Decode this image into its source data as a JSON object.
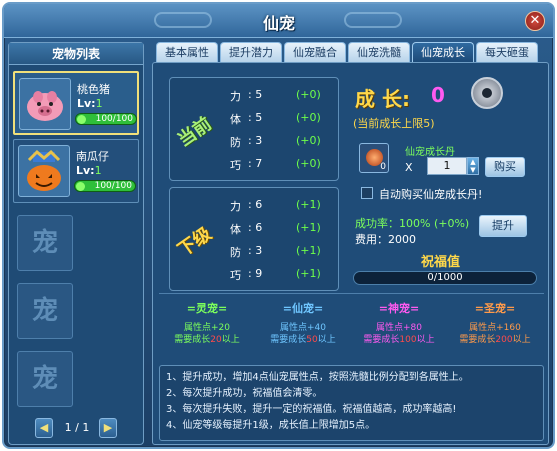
{
  "window": {
    "title": "仙宠"
  },
  "left": {
    "header": "宠物列表",
    "pets": [
      {
        "name": "桃色猪",
        "level_label": "Lv:",
        "level": "1",
        "hp": "100/100"
      },
      {
        "name": "南瓜仔",
        "level_label": "Lv:",
        "level": "1",
        "hp": "100/100"
      }
    ],
    "empty_slot_char": "宠",
    "pager": {
      "text": "1 / 1",
      "prev": "◀",
      "next": "▶"
    }
  },
  "tabs": [
    "基本属性",
    "提升潜力",
    "仙宠融合",
    "仙宠洗髓",
    "仙宠成长",
    "每天砸蛋"
  ],
  "active_tab": 4,
  "current": {
    "label": "当前",
    "rows": [
      {
        "k": "力",
        "v": ": 5",
        "d": "(+0)"
      },
      {
        "k": "体",
        "v": ": 5",
        "d": "(+0)"
      },
      {
        "k": "防",
        "v": ": 3",
        "d": "(+0)"
      },
      {
        "k": "巧",
        "v": ": 7",
        "d": "(+0)"
      }
    ]
  },
  "next": {
    "label": "下级",
    "rows": [
      {
        "k": "力",
        "v": ": 6",
        "d": "(+1)"
      },
      {
        "k": "体",
        "v": ": 6",
        "d": "(+1)"
      },
      {
        "k": "防",
        "v": ": 3",
        "d": "(+1)"
      },
      {
        "k": "巧",
        "v": ": 9",
        "d": "(+1)"
      }
    ]
  },
  "growth": {
    "label": "成 长:",
    "value": "0",
    "limit": "(当前成长上限5)"
  },
  "item": {
    "name": "仙宠成长丹",
    "count": "0",
    "x": "X",
    "qty": "1",
    "buy": "购买"
  },
  "auto_buy": "自动购买仙宠成长丹!",
  "success_rate": "成功率：100% (+0%)",
  "cost": "费用：2000",
  "upgrade": "提升",
  "blessing": {
    "title": "祝福值",
    "text": "0/1000",
    "fraction": 0.0
  },
  "tiers": [
    {
      "name": "=灵宠=",
      "l1": "属性点+20",
      "l2a": "需要成长",
      "l2b": "20",
      "l2c": "以上",
      "color": "#7cff5c"
    },
    {
      "name": "=仙宠=",
      "l1": "属性点+40",
      "l2a": "需要成长",
      "l2b": "50",
      "l2c": "以上",
      "color": "#6fc6ff"
    },
    {
      "name": "=神宠=",
      "l1": "属性点+80",
      "l2a": "需要成长",
      "l2b": "100",
      "l2c": "以上",
      "color": "#ff5af0"
    },
    {
      "name": "=圣宠=",
      "l1": "属性点+160",
      "l2a": "需要成长",
      "l2b": "200",
      "l2c": "以上",
      "color": "#ff9a4a"
    }
  ],
  "notes": [
    "1、提升成功，增加4点仙宠属性点，按照洗髓比例分配到各属性上。",
    "2、每次提升成功，祝福值会清零。",
    "3、每次提升失败，提升一定的祝福值。祝福值越高，成功率越高!",
    "4、仙宠等级每提升1级，成长值上限增加5点。"
  ],
  "colors": {
    "accent": "#ffd84a",
    "green": "#7cff5c",
    "pink": "#ff5af0",
    "panel": "#1f4c78"
  }
}
